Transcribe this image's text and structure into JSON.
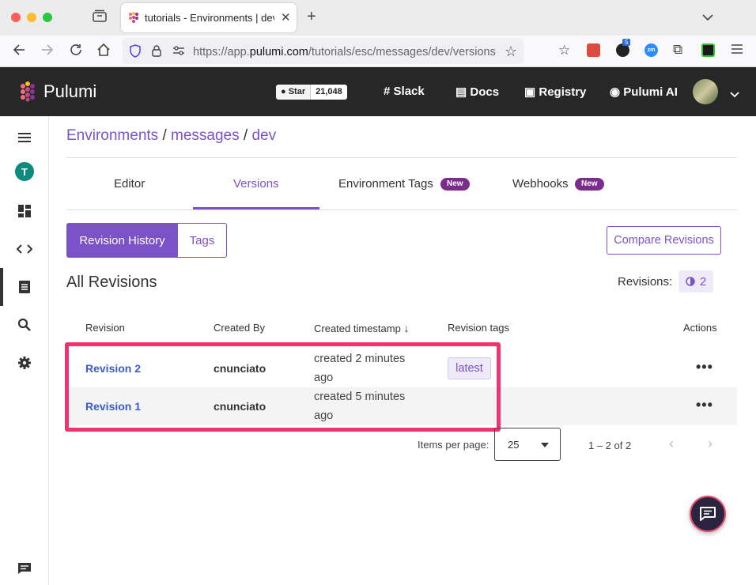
{
  "browser": {
    "tab_title": "tutorials - Environments | dev | Pulumi",
    "url_prefix": "https://app.",
    "url_domain": "pulumi.com",
    "url_path": "/tutorials/esc/messages/dev/versions",
    "extension_badge": "5"
  },
  "header": {
    "brand": "Pulumi",
    "star_label": "Star",
    "star_count": "21,048",
    "nav": [
      "Slack",
      "Docs",
      "Registry",
      "Pulumi AI"
    ]
  },
  "sidebar": {
    "org_initial": "T"
  },
  "breadcrumb": {
    "root": "Environments",
    "separator": "/",
    "project": "messages",
    "env": "dev"
  },
  "tabs": {
    "editor": "Editor",
    "versions": "Versions",
    "environment_tags": "Environment Tags",
    "webhooks": "Webhooks",
    "new_badge": "New"
  },
  "segments": {
    "revision_history": "Revision History",
    "tags": "Tags"
  },
  "compare_button": "Compare Revisions",
  "section_title": "All Revisions",
  "revisions_label": "Revisions:",
  "revisions_count": "2",
  "table": {
    "headers": {
      "revision": "Revision",
      "created_by": "Created By",
      "created_timestamp": "Created timestamp",
      "revision_tags": "Revision tags",
      "actions": "Actions"
    },
    "rows": [
      {
        "revision": "Revision 2",
        "created_by": "cnunciato",
        "timestamp": "created 2 minutes ago",
        "tag": "latest"
      },
      {
        "revision": "Revision 1",
        "created_by": "cnunciato",
        "timestamp": "created 5 minutes ago",
        "tag": ""
      }
    ]
  },
  "pagination": {
    "items_per_page_label": "Items per page:",
    "items_per_page": "25",
    "range": "1 – 2 of 2"
  },
  "colors": {
    "accent": "#7b52c7",
    "header_bg": "#272727",
    "highlight": "#f1346f",
    "link_blue": "#3b5bd6"
  }
}
